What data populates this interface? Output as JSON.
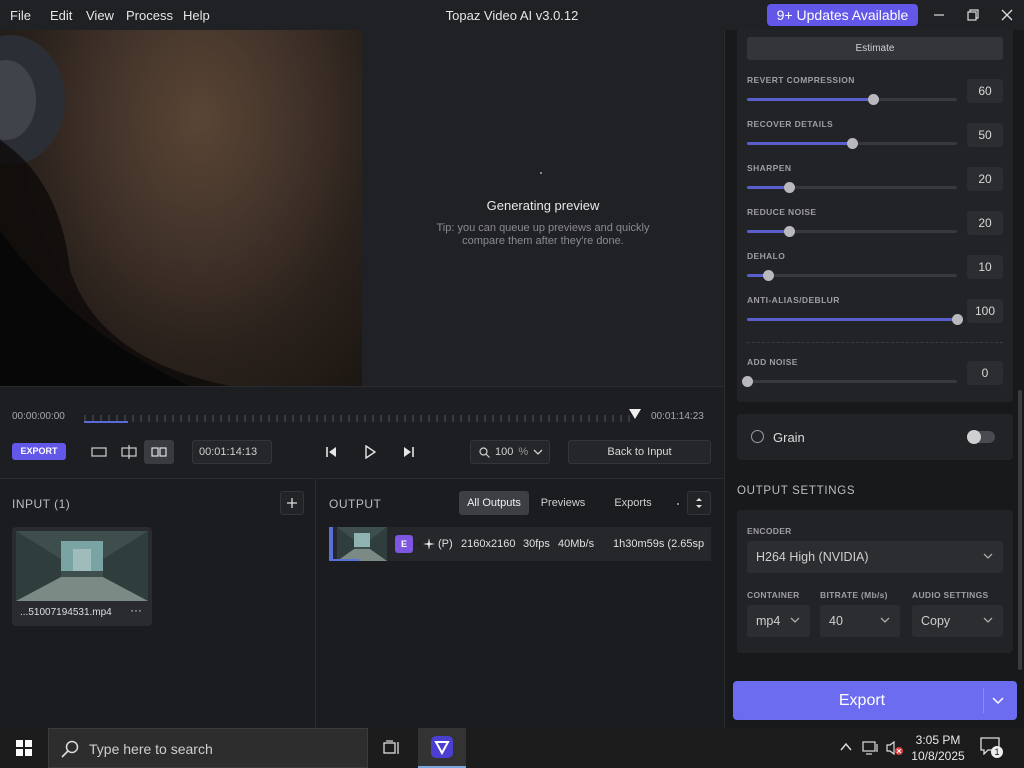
{
  "window": {
    "title": "Topaz Video AI  v3.0.12",
    "menu": [
      "File",
      "Edit",
      "View",
      "Process",
      "Help"
    ],
    "updates_label": "9+ Updates Available"
  },
  "preview": {
    "status": "Generating preview",
    "tip": "Tip: you can queue up previews and quickly compare them after they're done."
  },
  "timeline": {
    "start_time": "00:00:00:00",
    "end_time": "00:01:14:23",
    "export_label": "EXPORT",
    "current_timecode": "00:01:14:13",
    "zoom_value": "100",
    "zoom_unit": "%",
    "back_label": "Back to Input"
  },
  "input": {
    "title": "INPUT (1)",
    "filename": "...51007194531.mp4",
    "more": "···"
  },
  "output": {
    "title": "OUTPUT",
    "tabs": [
      "All Outputs",
      "Previews",
      "Exports"
    ],
    "active_tab": "All Outputs",
    "row": {
      "badge": "E",
      "mode": "(P)",
      "resolution": "2160x2160",
      "fps": "30fps",
      "bitrate": "40Mb/s",
      "eta": "1h30m59s (2.65sp"
    }
  },
  "settings": {
    "estimate_label": "Estimate",
    "sliders": [
      {
        "label": "REVERT COMPRESSION",
        "value": "60",
        "fraction": 0.6
      },
      {
        "label": "RECOVER DETAILS",
        "value": "50",
        "fraction": 0.5
      },
      {
        "label": "SHARPEN",
        "value": "20",
        "fraction": 0.2
      },
      {
        "label": "REDUCE NOISE",
        "value": "20",
        "fraction": 0.2
      },
      {
        "label": "DEHALO",
        "value": "10",
        "fraction": 0.1
      },
      {
        "label": "ANTI-ALIAS/DEBLUR",
        "value": "100",
        "fraction": 1.0
      },
      {
        "label": "ADD NOISE",
        "value": "0",
        "fraction": 0.0
      }
    ],
    "grain_label": "Grain",
    "grain_enabled": false
  },
  "output_settings": {
    "title": "OUTPUT SETTINGS",
    "encoder_label": "ENCODER",
    "encoder_value": "H264 High (NVIDIA)",
    "container_label": "CONTAINER",
    "container_value": "mp4",
    "bitrate_label": "BITRATE (Mb/s)",
    "bitrate_value": "40",
    "audio_label": "AUDIO SETTINGS",
    "audio_value": "Copy",
    "export_label": "Export"
  },
  "taskbar": {
    "search_placeholder": "Type here to search",
    "time": "3:05 PM",
    "date": "10/8/2025",
    "notification_count": "1"
  },
  "colors": {
    "accent": "#6257e8",
    "export_button": "#6b6cf0",
    "slider_fill": "#5b5fcc"
  }
}
